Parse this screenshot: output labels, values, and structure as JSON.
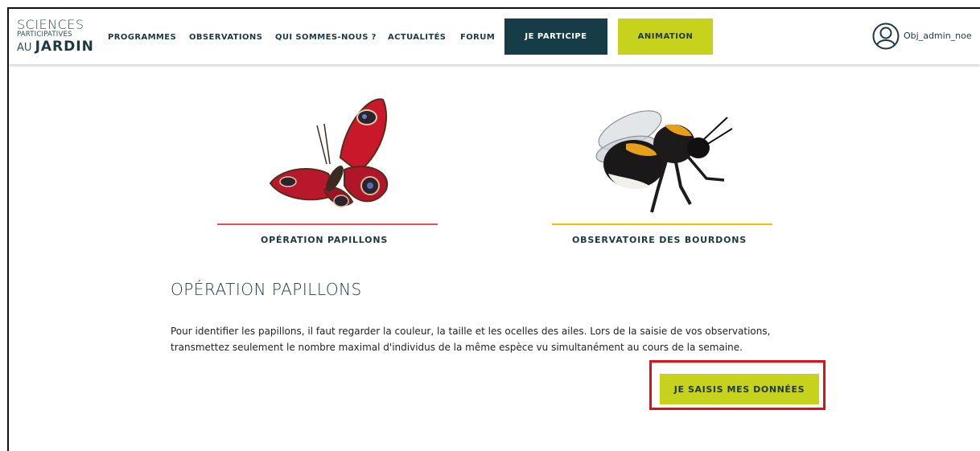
{
  "header": {
    "logo": {
      "line1": "SCIENCES",
      "line2": "PARTICIPATIVES",
      "line3_prefix": "AU",
      "line3_bold": "JARDIN"
    },
    "nav": [
      "PROGRAMMES",
      "OBSERVATIONS",
      "QUI SOMMES-NOUS ?",
      "ACTUALITÉS",
      "FORUM"
    ],
    "participe_label": "JE PARTICIPE",
    "animation_label": "ANIMATION",
    "username": "Obj_admin_noe"
  },
  "programs": [
    {
      "label": "OPÉRATION PAPILLONS",
      "accent": "#e8514f",
      "icon": "butterfly-illustration"
    },
    {
      "label": "OBSERVATOIRE DES BOURDONS",
      "accent": "#f0c000",
      "icon": "bumblebee-illustration"
    }
  ],
  "main": {
    "title": "OPÉRATION PAPILLONS",
    "description": "Pour identifier les papillons, il faut regarder la couleur, la taille et les ocelles des ailes. Lors de la saisie de vos observations, transmettez seulement le nombre maximal d'individus de la même espèce vu simultanément au cours de la semaine.",
    "cta_label": "JE SAISIS MES DONNÉES"
  },
  "colors": {
    "brand_dark": "#153c47",
    "brand_lime": "#c7d21c",
    "highlight_red": "#e0101a"
  }
}
